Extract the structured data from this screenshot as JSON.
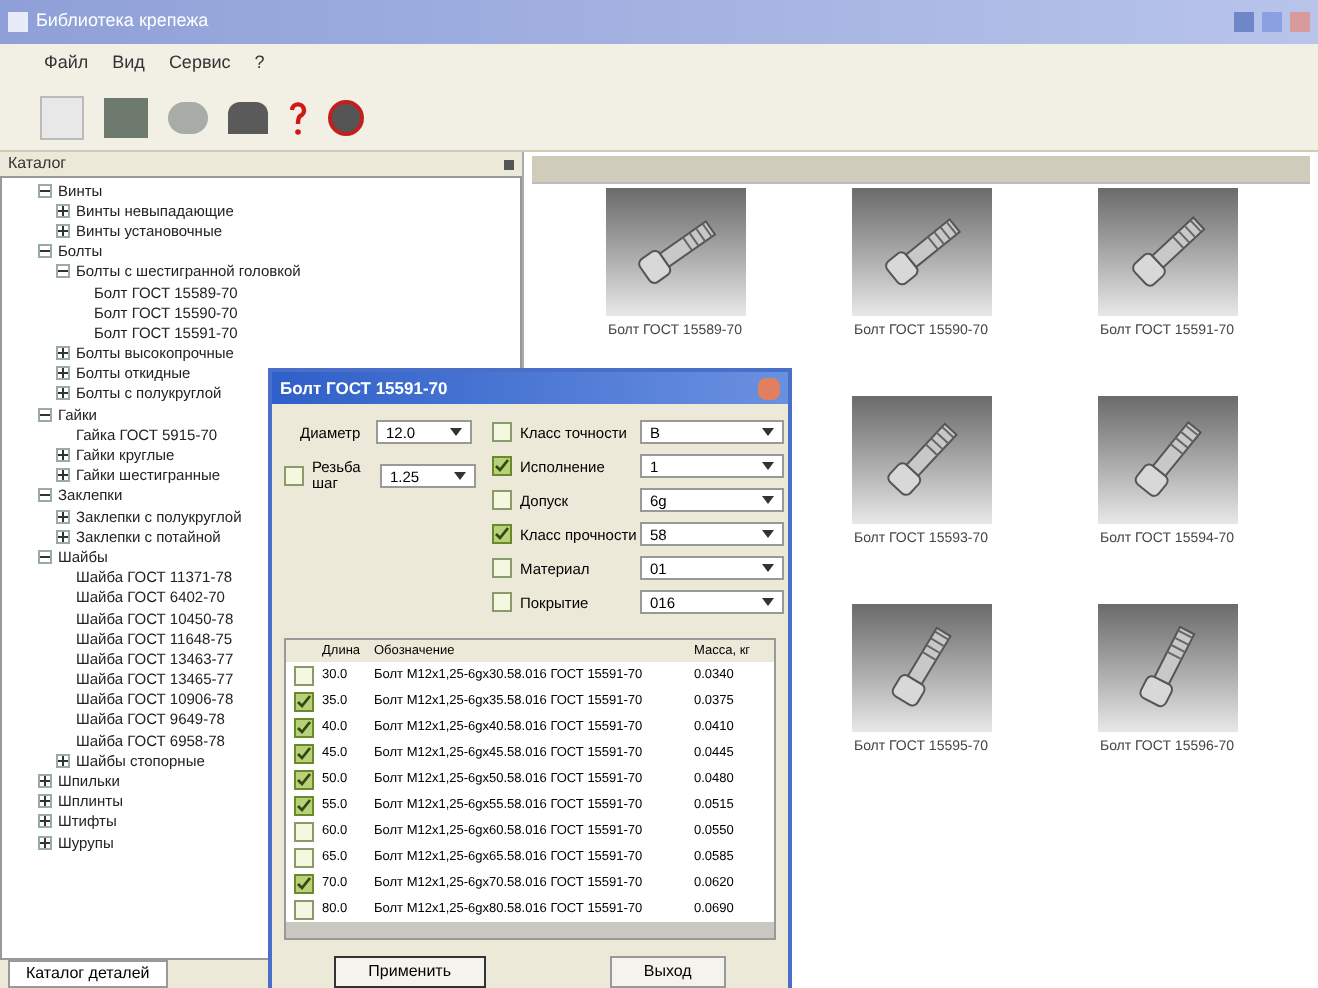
{
  "window": {
    "title": "Библиотека крепежа"
  },
  "menu": [
    "Файл",
    "Вид",
    "Сервис",
    "?"
  ],
  "panel": {
    "title": "Каталог",
    "tab": "Каталог деталей"
  },
  "tree": [
    {
      "label": "Винты",
      "expanded": true,
      "children": [
        {
          "label": "Винты невыпадающие",
          "expanded": false
        },
        {
          "label": "Винты установочные",
          "expanded": false
        }
      ]
    },
    {
      "label": "Болты",
      "expanded": true,
      "children": [
        {
          "label": "Болты с шестигранной головкой",
          "expanded": true,
          "children": [
            {
              "label": "Болт ГОСТ 15589-70"
            },
            {
              "label": "Болт ГОСТ 15590-70"
            },
            {
              "label": "Болт ГОСТ 15591-70"
            }
          ]
        },
        {
          "label": "Болты высокопрочные",
          "expanded": false
        },
        {
          "label": "Болты откидные",
          "expanded": false
        },
        {
          "label": "Болты с полукруглой",
          "expanded": false
        }
      ]
    },
    {
      "label": "Гайки",
      "expanded": true,
      "children": [
        {
          "label": "Гайка ГОСТ 5915-70"
        },
        {
          "label": "Гайки круглые",
          "expanded": false
        },
        {
          "label": "Гайки шестигранные",
          "expanded": false
        }
      ]
    },
    {
      "label": "Заклепки",
      "expanded": true,
      "children": [
        {
          "label": "Заклепки с полукруглой",
          "expanded": false
        },
        {
          "label": "Заклепки с потайной",
          "expanded": false
        }
      ]
    },
    {
      "label": "Шайбы",
      "expanded": true,
      "children": [
        {
          "label": "Шайба ГОСТ 11371-78"
        },
        {
          "label": "Шайба ГОСТ 6402-70"
        },
        {
          "label": "Шайба ГОСТ 10450-78"
        },
        {
          "label": "Шайба ГОСТ 11648-75"
        },
        {
          "label": "Шайба ГОСТ 13463-77"
        },
        {
          "label": "Шайба ГОСТ 13465-77"
        },
        {
          "label": "Шайба ГОСТ 10906-78"
        },
        {
          "label": "Шайба ГОСТ 9649-78"
        },
        {
          "label": "Шайба ГОСТ 6958-78"
        },
        {
          "label": "Шайбы стопорные",
          "expanded": false
        }
      ]
    },
    {
      "label": "Шпильки",
      "expanded": false
    },
    {
      "label": "Шплинты",
      "expanded": false
    },
    {
      "label": "Штифты",
      "expanded": false
    },
    {
      "label": "Шурупы",
      "expanded": false
    }
  ],
  "gallery": [
    [
      {
        "caption": "Болт ГОСТ 15589-70"
      },
      {
        "caption": "Болт ГОСТ 15590-70"
      },
      {
        "caption": "Болт ГОСТ 15591-70"
      }
    ],
    [
      {
        "caption": "Болт ГОСТ 15593-70"
      },
      {
        "caption": "Болт ГОСТ 15594-70"
      }
    ],
    [
      {
        "caption": "Болт ГОСТ 15595-70"
      },
      {
        "caption": "Болт ГОСТ 15596-70"
      }
    ]
  ],
  "dialog": {
    "title": "Болт ГОСТ 15591-70",
    "diameter": {
      "label": "Диаметр",
      "value": "12.0"
    },
    "pitch": {
      "label": "Резьба шаг",
      "value": "1.25",
      "checked": false
    },
    "params": [
      {
        "label": "Класс точности",
        "value": "В",
        "checked": false
      },
      {
        "label": "Исполнение",
        "value": "1",
        "checked": true
      },
      {
        "label": "Допуск",
        "value": "6g",
        "checked": false
      },
      {
        "label": "Класс прочности",
        "value": "58",
        "checked": true
      },
      {
        "label": "Материал",
        "value": "01",
        "checked": false
      },
      {
        "label": "Покрытие",
        "value": "016",
        "checked": false
      }
    ],
    "columns": [
      "Длина",
      "Обозначение",
      "Масса, кг"
    ],
    "rows": [
      {
        "checked": false,
        "cells": [
          "30.0",
          "Болт М12х1,25-6gх30.58.016 ГОСТ 15591-70",
          "0.0340"
        ]
      },
      {
        "checked": true,
        "cells": [
          "35.0",
          "Болт М12х1,25-6gх35.58.016 ГОСТ 15591-70",
          "0.0375"
        ]
      },
      {
        "checked": true,
        "cells": [
          "40.0",
          "Болт М12х1,25-6gх40.58.016 ГОСТ 15591-70",
          "0.0410"
        ]
      },
      {
        "checked": true,
        "cells": [
          "45.0",
          "Болт М12х1,25-6gх45.58.016 ГОСТ 15591-70",
          "0.0445"
        ]
      },
      {
        "checked": true,
        "cells": [
          "50.0",
          "Болт М12х1,25-6gх50.58.016 ГОСТ 15591-70",
          "0.0480"
        ]
      },
      {
        "checked": true,
        "cells": [
          "55.0",
          "Болт М12х1,25-6gх55.58.016 ГОСТ 15591-70",
          "0.0515"
        ]
      },
      {
        "checked": false,
        "cells": [
          "60.0",
          "Болт М12х1,25-6gх60.58.016 ГОСТ 15591-70",
          "0.0550"
        ]
      },
      {
        "checked": false,
        "cells": [
          "65.0",
          "Болт М12х1,25-6gх65.58.016 ГОСТ 15591-70",
          "0.0585"
        ]
      },
      {
        "checked": true,
        "cells": [
          "70.0",
          "Болт М12х1,25-6gх70.58.016 ГОСТ 15591-70",
          "0.0620"
        ]
      },
      {
        "checked": false,
        "cells": [
          "80.0",
          "Болт М12х1,25-6gх80.58.016 ГОСТ 15591-70",
          "0.0690"
        ]
      }
    ],
    "buttons": [
      "Применить",
      "Выход"
    ]
  }
}
